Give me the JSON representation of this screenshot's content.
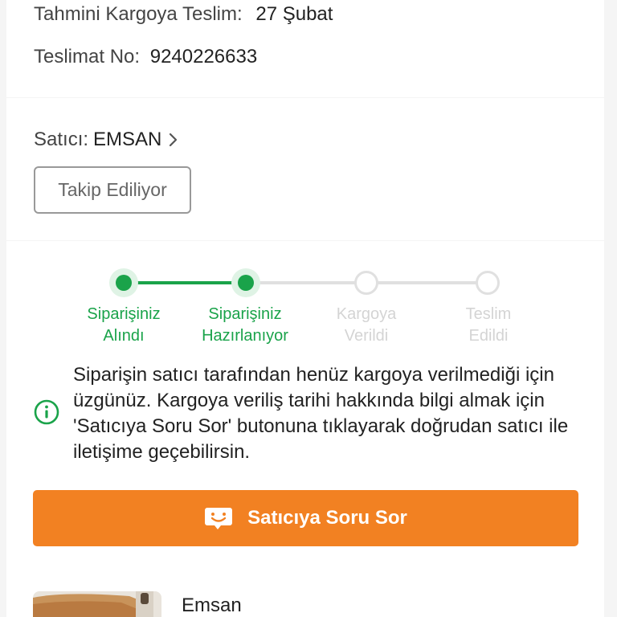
{
  "delivery": {
    "estimate_label": "Tahmini Kargoya Teslim:",
    "estimate_value": "27 Şubat",
    "number_label": "Teslimat No:",
    "number_value": "9240226633"
  },
  "seller": {
    "label": "Satıcı:",
    "name": "EMSAN",
    "follow_label": "Takip Ediliyor"
  },
  "status": {
    "steps": [
      {
        "line1": "Siparişiniz",
        "line2": "Alındı",
        "state": "done"
      },
      {
        "line1": "Siparişiniz",
        "line2": "Hazırlanıyor",
        "state": "done"
      },
      {
        "line1": "Kargoya",
        "line2": "Verildi",
        "state": "todo"
      },
      {
        "line1": "Teslim",
        "line2": "Edildi",
        "state": "todo"
      }
    ],
    "info_text": "Siparişin satıcı tarafından henüz kargoya verilmediği için üzgünüz. Kargoya veriliş tarihi hakkında bilgi almak için 'Satıcıya Soru Sor' butonuna tıklayarak doğrudan satıcı ile iletişime geçebilirsin.",
    "ask_button_label": "Satıcıya Soru Sor"
  },
  "product": {
    "brand": "Emsan"
  },
  "colors": {
    "accent_green": "#1aa34a",
    "accent_orange": "#f28122",
    "inactive_gray": "#e0e0e0"
  },
  "icons": {
    "seller_chevron": "chevron-right-icon",
    "info": "info-icon",
    "ask": "chat-smile-icon"
  }
}
